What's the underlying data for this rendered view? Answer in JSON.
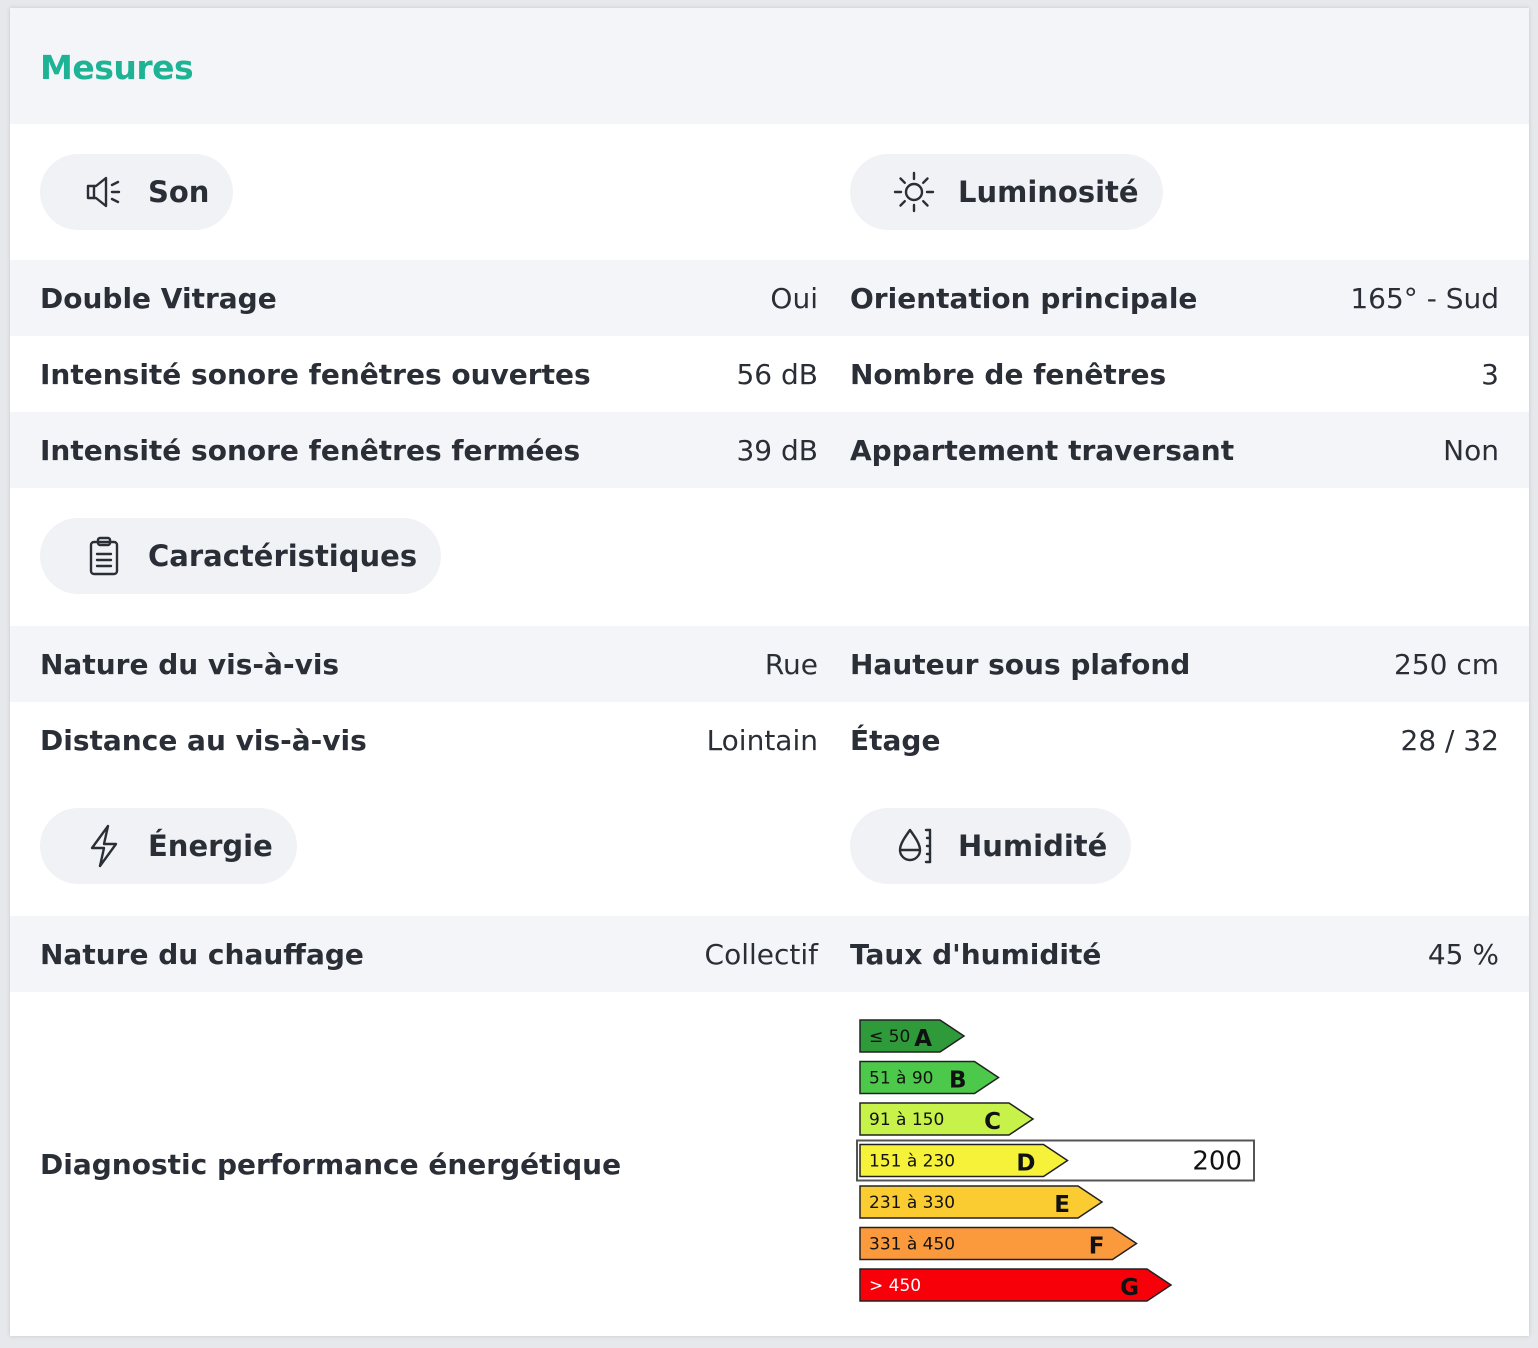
{
  "title": "Mesures",
  "sections": {
    "son": {
      "label": "Son"
    },
    "luminosite": {
      "label": "Luminosité"
    },
    "caracteristiques": {
      "label": "Caractéristiques"
    },
    "energie": {
      "label": "Énergie"
    },
    "humidite": {
      "label": "Humidité"
    }
  },
  "son_rows": [
    {
      "key": "Double Vitrage",
      "value": "Oui"
    },
    {
      "key": "Intensité sonore fenêtres ouvertes",
      "value": "56 dB"
    },
    {
      "key": "Intensité sonore fenêtres fermées",
      "value": "39 dB"
    }
  ],
  "luminosite_rows": [
    {
      "key": "Orientation principale",
      "value": "165° - Sud"
    },
    {
      "key": "Nombre de fenêtres",
      "value": "3"
    },
    {
      "key": "Appartement traversant",
      "value": "Non"
    }
  ],
  "carac_left_rows": [
    {
      "key": "Nature du vis-à-vis",
      "value": "Rue"
    },
    {
      "key": "Distance au vis-à-vis",
      "value": "Lointain"
    }
  ],
  "carac_right_rows": [
    {
      "key": "Hauteur sous plafond",
      "value": "250 cm"
    },
    {
      "key": "Étage",
      "value": "28 / 32"
    }
  ],
  "energie_rows": [
    {
      "key": "Nature du chauffage",
      "value": "Collectif"
    }
  ],
  "humidite_rows": [
    {
      "key": "Taux d'humidité",
      "value": "45 %"
    }
  ],
  "dpe": {
    "label": "Diagnostic performance énergétique",
    "value": "200",
    "selected_class": "D",
    "classes": [
      {
        "range": "≤ 50",
        "letter": "A",
        "color": "#2e9a3a"
      },
      {
        "range": "51 à 90",
        "letter": "B",
        "color": "#4cc94a"
      },
      {
        "range": "91 à 150",
        "letter": "C",
        "color": "#c7f24a"
      },
      {
        "range": "151 à 230",
        "letter": "D",
        "color": "#f6f23a"
      },
      {
        "range": "231 à 330",
        "letter": "E",
        "color": "#fbcb32"
      },
      {
        "range": "331 à 450",
        "letter": "F",
        "color": "#fb9a3c"
      },
      {
        "range": "> 450",
        "letter": "G",
        "color": "#f8000a"
      }
    ]
  }
}
